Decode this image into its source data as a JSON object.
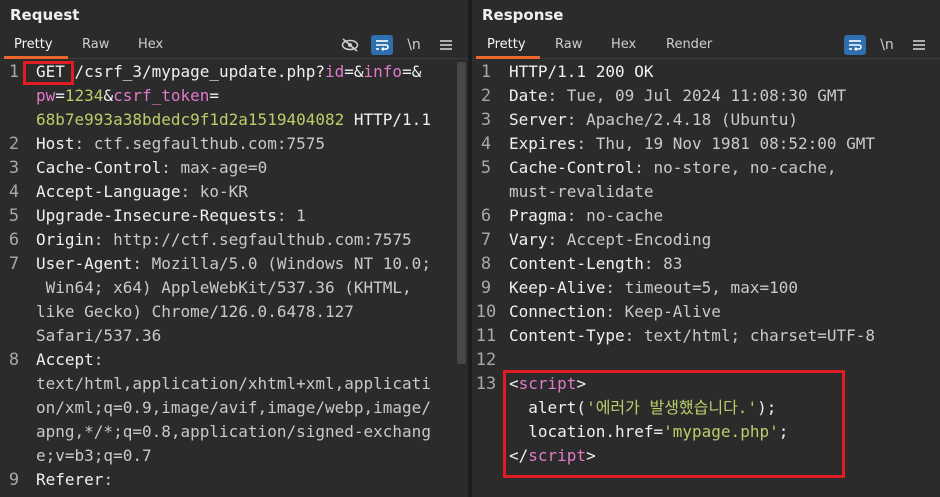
{
  "request": {
    "title": "Request",
    "tabs": [
      "Pretty",
      "Raw",
      "Hex"
    ],
    "tools": {
      "ln_label": "\\n"
    },
    "lines": [
      {
        "num": "1",
        "parts": [
          {
            "t": "GET",
            "c": "t"
          },
          {
            "t": " /csrf_3/mypage_update.php?",
            "c": "t"
          },
          {
            "t": "id",
            "c": "p"
          },
          {
            "t": "=&",
            "c": "t"
          },
          {
            "t": "info",
            "c": "p"
          },
          {
            "t": "=&",
            "c": "t"
          }
        ]
      },
      {
        "num": "",
        "parts": [
          {
            "t": "pw",
            "c": "p"
          },
          {
            "t": "=",
            "c": "t"
          },
          {
            "t": "1234",
            "c": "g"
          },
          {
            "t": "&",
            "c": "t"
          },
          {
            "t": "csrf_token",
            "c": "p"
          },
          {
            "t": "=",
            "c": "t"
          }
        ]
      },
      {
        "num": "",
        "parts": [
          {
            "t": "68b7e993a38bdedc9f1d2a1519404082",
            "c": "g"
          },
          {
            "t": " HTTP/1.1",
            "c": "t"
          }
        ]
      },
      {
        "num": "2",
        "parts": [
          {
            "t": "Host",
            "c": "k"
          },
          {
            "t": ": ctf.segfaulthub.com:7575",
            "c": "v"
          }
        ]
      },
      {
        "num": "3",
        "parts": [
          {
            "t": "Cache-Control",
            "c": "k"
          },
          {
            "t": ": max-age=0",
            "c": "v"
          }
        ]
      },
      {
        "num": "4",
        "parts": [
          {
            "t": "Accept-Language",
            "c": "k"
          },
          {
            "t": ": ko-KR",
            "c": "v"
          }
        ]
      },
      {
        "num": "5",
        "parts": [
          {
            "t": "Upgrade-Insecure-Requests",
            "c": "k"
          },
          {
            "t": ": 1",
            "c": "v"
          }
        ]
      },
      {
        "num": "6",
        "parts": [
          {
            "t": "Origin",
            "c": "k"
          },
          {
            "t": ": http://ctf.segfaulthub.com:7575",
            "c": "v"
          }
        ]
      },
      {
        "num": "7",
        "parts": [
          {
            "t": "User-Agent",
            "c": "k"
          },
          {
            "t": ": Mozilla/5.0 (Windows NT 10.0;",
            "c": "v"
          }
        ]
      },
      {
        "num": "",
        "parts": [
          {
            "t": " Win64; x64) AppleWebKit/537.36 (KHTML,",
            "c": "v"
          }
        ]
      },
      {
        "num": "",
        "parts": [
          {
            "t": "like Gecko) Chrome/126.0.6478.127",
            "c": "v"
          }
        ]
      },
      {
        "num": "",
        "parts": [
          {
            "t": "Safari/537.36",
            "c": "v"
          }
        ]
      },
      {
        "num": "8",
        "parts": [
          {
            "t": "Accept",
            "c": "k"
          },
          {
            "t": ":",
            "c": "v"
          }
        ]
      },
      {
        "num": "",
        "parts": [
          {
            "t": "text/html,application/xhtml+xml,applicati",
            "c": "v"
          }
        ]
      },
      {
        "num": "",
        "parts": [
          {
            "t": "on/xml;q=0.9,image/avif,image/webp,image/",
            "c": "v"
          }
        ]
      },
      {
        "num": "",
        "parts": [
          {
            "t": "apng,*/*;q=0.8,application/signed-exchang",
            "c": "v"
          }
        ]
      },
      {
        "num": "",
        "parts": [
          {
            "t": "e;v=b3;q=0.7",
            "c": "v"
          }
        ]
      },
      {
        "num": "9",
        "parts": [
          {
            "t": "Referer",
            "c": "k"
          },
          {
            "t": ":",
            "c": "v"
          }
        ]
      }
    ]
  },
  "response": {
    "title": "Response",
    "tabs": [
      "Pretty",
      "Raw",
      "Hex",
      "Render"
    ],
    "tools": {
      "ln_label": "\\n"
    },
    "lines": [
      {
        "num": "1",
        "parts": [
          {
            "t": "HTTP/1.1 200 OK",
            "c": "t"
          }
        ]
      },
      {
        "num": "2",
        "parts": [
          {
            "t": "Date",
            "c": "k"
          },
          {
            "t": ": Tue, 09 Jul 2024 11:08:30 GMT",
            "c": "v"
          }
        ]
      },
      {
        "num": "3",
        "parts": [
          {
            "t": "Server",
            "c": "k"
          },
          {
            "t": ": Apache/2.4.18 (Ubuntu)",
            "c": "v"
          }
        ]
      },
      {
        "num": "4",
        "parts": [
          {
            "t": "Expires",
            "c": "k"
          },
          {
            "t": ": Thu, 19 Nov 1981 08:52:00 GMT",
            "c": "v"
          }
        ]
      },
      {
        "num": "5",
        "parts": [
          {
            "t": "Cache-Control",
            "c": "k"
          },
          {
            "t": ": no-store, no-cache,",
            "c": "v"
          }
        ]
      },
      {
        "num": "",
        "parts": [
          {
            "t": "must-revalidate",
            "c": "v"
          }
        ]
      },
      {
        "num": "6",
        "parts": [
          {
            "t": "Pragma",
            "c": "k"
          },
          {
            "t": ": no-cache",
            "c": "v"
          }
        ]
      },
      {
        "num": "7",
        "parts": [
          {
            "t": "Vary",
            "c": "k"
          },
          {
            "t": ": Accept-Encoding",
            "c": "v"
          }
        ]
      },
      {
        "num": "8",
        "parts": [
          {
            "t": "Content-Length",
            "c": "k"
          },
          {
            "t": ": 83",
            "c": "v"
          }
        ]
      },
      {
        "num": "9",
        "parts": [
          {
            "t": "Keep-Alive",
            "c": "k"
          },
          {
            "t": ": timeout=5, max=100",
            "c": "v"
          }
        ]
      },
      {
        "num": "10",
        "parts": [
          {
            "t": "Connection",
            "c": "k"
          },
          {
            "t": ": Keep-Alive",
            "c": "v"
          }
        ]
      },
      {
        "num": "11",
        "parts": [
          {
            "t": "Content-Type",
            "c": "k"
          },
          {
            "t": ": text/html; charset=UTF-8",
            "c": "v"
          }
        ]
      },
      {
        "num": "12",
        "parts": []
      },
      {
        "num": "13",
        "parts": [
          {
            "t": "<",
            "c": "t"
          },
          {
            "t": "script",
            "c": "tag"
          },
          {
            "t": ">",
            "c": "t"
          }
        ]
      },
      {
        "num": "",
        "parts": [
          {
            "t": "  alert(",
            "c": "t"
          },
          {
            "t": "'에러가 발생했습니다.'",
            "c": "str"
          },
          {
            "t": ");",
            "c": "t"
          }
        ]
      },
      {
        "num": "",
        "parts": [
          {
            "t": "  location.href=",
            "c": "t"
          },
          {
            "t": "'mypage.php'",
            "c": "str"
          },
          {
            "t": ";",
            "c": "t"
          }
        ]
      },
      {
        "num": "",
        "parts": [
          {
            "t": "</",
            "c": "t"
          },
          {
            "t": "script",
            "c": "tag"
          },
          {
            "t": ">",
            "c": "t"
          }
        ]
      }
    ]
  },
  "colors": {
    "accent_tab": "#e8672c",
    "highlight_box": "#e11c22",
    "tool_on": "#2f6fb0"
  }
}
